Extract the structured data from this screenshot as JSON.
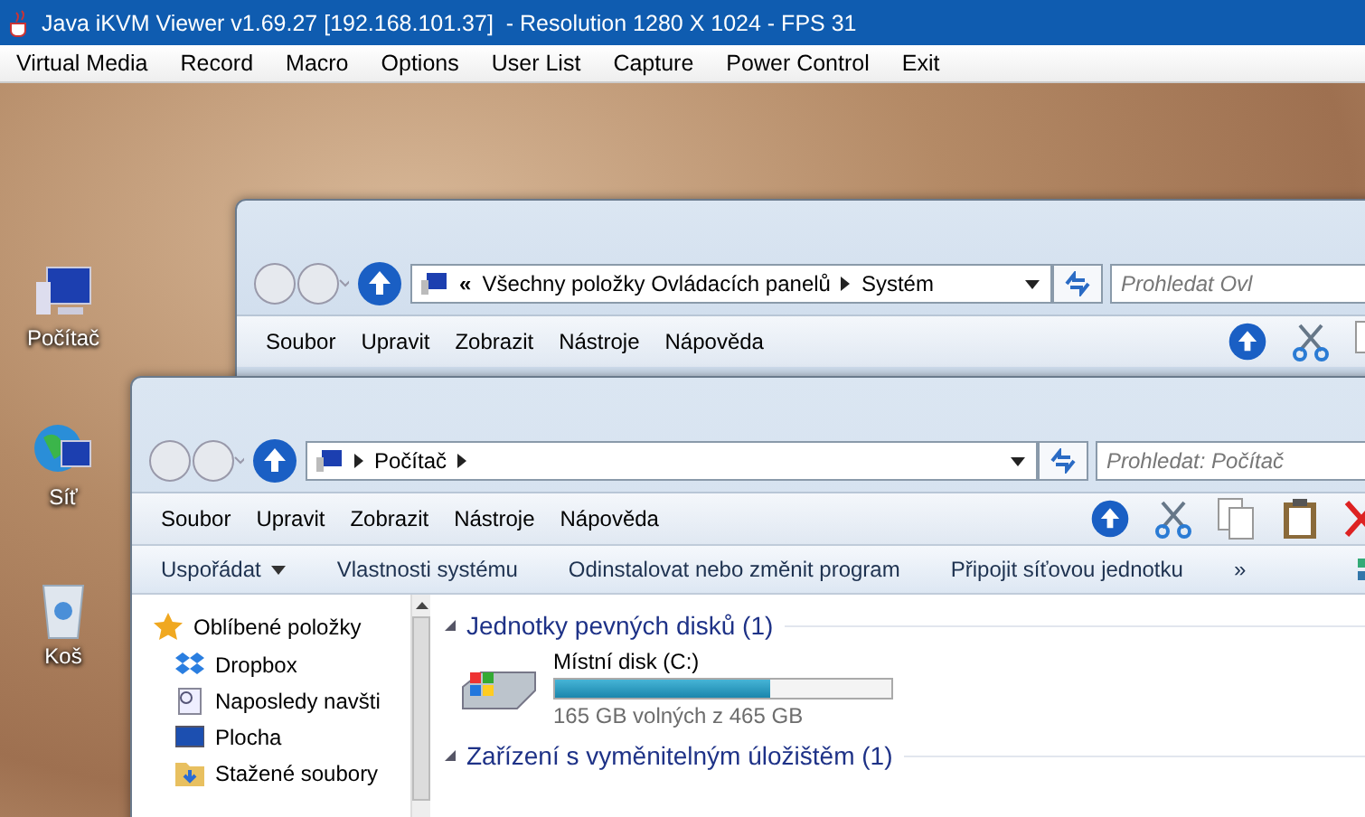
{
  "window": {
    "title": "Java iKVM Viewer v1.69.27 [192.168.101.37]  - Resolution 1280 X 1024 - FPS 31"
  },
  "menu": [
    "Virtual Media",
    "Record",
    "Macro",
    "Options",
    "User List",
    "Capture",
    "Power Control",
    "Exit"
  ],
  "desktop_icons": [
    {
      "label": "Počítač",
      "kind": "computer"
    },
    {
      "label": "Síť",
      "kind": "network"
    },
    {
      "label": "Koš",
      "kind": "bin"
    }
  ],
  "back_window": {
    "address_prefix": "«",
    "address": [
      "Všechny položky Ovládacích panelů",
      "Systém"
    ],
    "search": {
      "placeholder": "Prohledat Ovl"
    },
    "menu": [
      "Soubor",
      "Upravit",
      "Zobrazit",
      "Nástroje",
      "Nápověda"
    ]
  },
  "front_window": {
    "address": [
      "Počítač"
    ],
    "search": {
      "placeholder": "Prohledat: Počítač"
    },
    "menu": [
      "Soubor",
      "Upravit",
      "Zobrazit",
      "Nástroje",
      "Nápověda"
    ],
    "commands": [
      {
        "label": "Uspořádat",
        "dropdown": true
      },
      {
        "label": "Vlastnosti systému",
        "dropdown": false
      },
      {
        "label": "Odinstalovat nebo změnit program",
        "dropdown": false
      },
      {
        "label": "Připojit síťovou jednotku",
        "dropdown": false
      }
    ],
    "overflow": "»",
    "sidebar": [
      {
        "label": "Oblíbené položky",
        "kind": "star"
      },
      {
        "label": "Dropbox",
        "kind": "dropbox"
      },
      {
        "label": "Naposledy navšti",
        "kind": "recent"
      },
      {
        "label": "Plocha",
        "kind": "desktop"
      },
      {
        "label": "Stažené soubory",
        "kind": "folder"
      }
    ],
    "sections": [
      {
        "title": "Jednotky pevných disků (1)",
        "drives": [
          {
            "name": "Místní disk (C:)",
            "level": 0.64,
            "free": "165 GB volných z 465 GB"
          }
        ]
      },
      {
        "title": "Zařízení s vyměnitelným úložištěm (1)"
      }
    ]
  }
}
